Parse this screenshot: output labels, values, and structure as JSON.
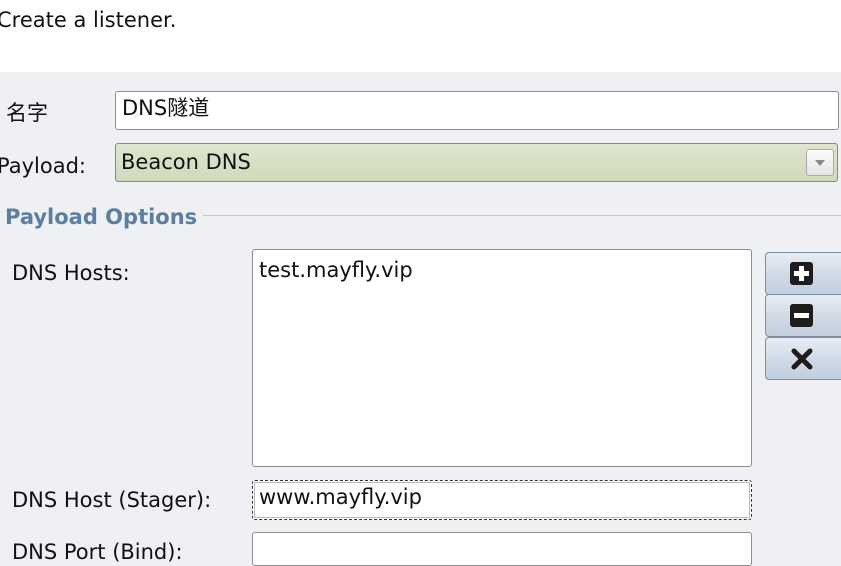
{
  "header": {
    "text": "Create a listener."
  },
  "form": {
    "name_label": "名字",
    "name_value": "DNS隧道",
    "payload_label": "Payload:",
    "payload_value": "Beacon DNS"
  },
  "payload_options": {
    "title": "Payload Options",
    "dns_hosts_label": "DNS Hosts:",
    "dns_hosts": [
      "test.mayfly.vip"
    ],
    "buttons": [
      {
        "icon": "plus-icon"
      },
      {
        "icon": "minus-icon"
      },
      {
        "icon": "x-icon"
      }
    ],
    "stager_label": "DNS Host (Stager):",
    "stager_value": "www.mayfly.vip",
    "port_label": "DNS Port (Bind):",
    "port_value": ""
  }
}
